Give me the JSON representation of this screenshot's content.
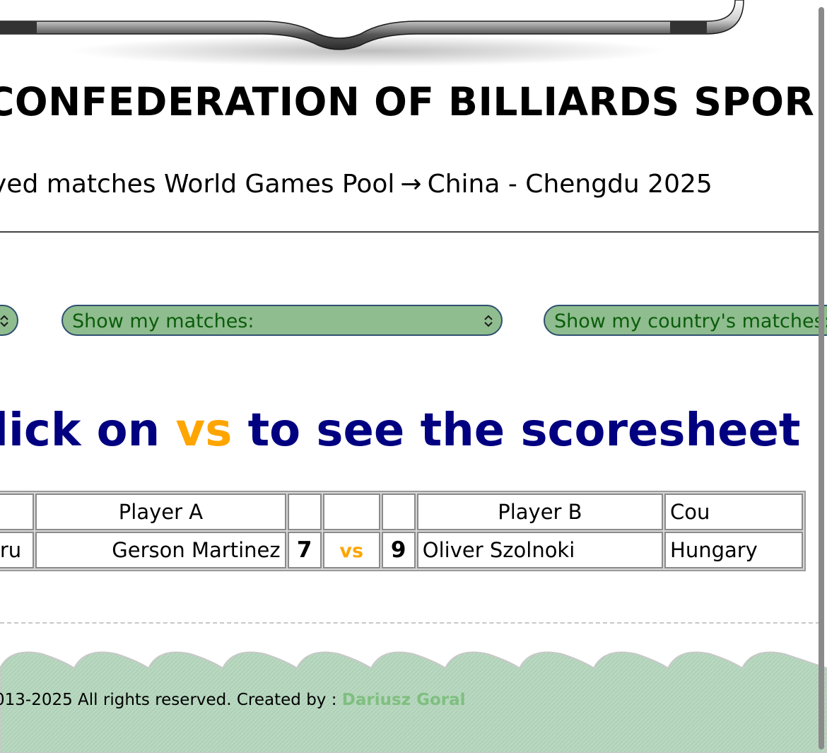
{
  "header": {
    "title": "CONFEDERATION OF BILLIARDS SPOR",
    "breadcrumb_left": "yed matches World Games Pool",
    "breadcrumb_arrow": "→",
    "breadcrumb_right": "China - Chengdu 2025"
  },
  "filters": {
    "left_select_label": "",
    "my_matches_label": "Show my matches:",
    "country_matches_label": "Show my country's matches:"
  },
  "instruction": {
    "prefix": "lick on",
    "vs": "vs",
    "suffix": "to see the scoresheet"
  },
  "table": {
    "headers": {
      "country_a": "",
      "player_a": "Player A",
      "score_a": "",
      "vs": "",
      "score_b": "",
      "player_b": "Player B",
      "country_b": "Cou"
    },
    "rows": [
      {
        "country_a": "eru",
        "player_a": "Gerson Martinez",
        "score_a": "7",
        "vs": "vs",
        "score_b": "9",
        "player_b": "Oliver Szolnoki",
        "country_b": "Hungary"
      }
    ]
  },
  "footer": {
    "copyright": "013-2025 All rights reserved. Created by :",
    "author": "Dariusz Goral"
  },
  "colors": {
    "select_bg": "#8fbd8f",
    "select_text": "#0b5c0b",
    "instruction": "#000080",
    "vs_accent": "#ffa500",
    "footer_bg": "#b8d8c0",
    "author_link": "#7fbf7f"
  },
  "icons": {
    "select_chevron": "chevron-up-down-icon",
    "cue_decoration": "cue-stick-icon"
  }
}
